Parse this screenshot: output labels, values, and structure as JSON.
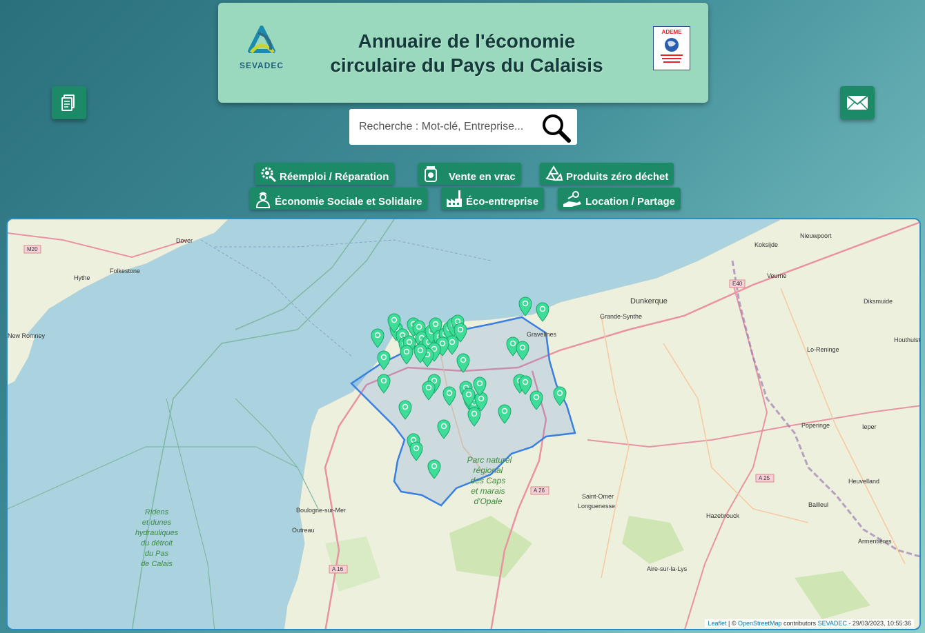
{
  "header": {
    "title_line1": "Annuaire de l'économie",
    "title_line2": "circulaire du Pays du Calaisis",
    "logo_left_text": "SEVADEC",
    "logo_right_text": "ADEME"
  },
  "search": {
    "placeholder": "Recherche : Mot-clé, Entreprise..."
  },
  "categories": [
    {
      "label": "Réemploi / Réparation"
    },
    {
      "label": "Vente en vrac"
    },
    {
      "label": "Produits zéro déchet"
    },
    {
      "label": "Économie Sociale et Solidaire"
    },
    {
      "label": "Éco-entreprise"
    },
    {
      "label": "Location / Partage"
    }
  ],
  "map": {
    "places": [
      "Dover",
      "Folkestone",
      "Hythe",
      "New Romney",
      "Dunkerque",
      "Grande-Synthe",
      "Gravelines",
      "Koksijde",
      "Nieuwpoort",
      "Veurne",
      "Diksmuide",
      "Houthulst",
      "Lo-Reninge",
      "Poperinge",
      "Ieper",
      "Heuvelland",
      "Bailleul",
      "Hazebrouck",
      "Armentières",
      "Saint-Omer",
      "Longuenesse",
      "Boulogne-sur-Mer",
      "Outreau",
      "Aire-sur-la-Lys"
    ],
    "roads": [
      "M20",
      "E40",
      "A 25",
      "A 26",
      "A 16",
      "A 16"
    ],
    "park_label": [
      "Parc naturel",
      "régional",
      "des Caps",
      "et marais",
      "d'Opale"
    ],
    "sea_label": [
      "Ridens",
      "et dunes",
      "hydrauliques",
      "du détroit",
      "du Pas",
      "de Calais"
    ],
    "marker_color": "#3ddc97",
    "boundary_color": "#3a7fe0"
  },
  "attribution": {
    "leaflet": "Leaflet",
    "sep": " | © ",
    "osm": "OpenStreetMap",
    "contrib": " contributors ",
    "sevadec": "SEVADEC",
    "date": " - 29/03/2023, 10:55:36"
  },
  "colors": {
    "button_green": "#1c8a67",
    "header_bg": "#9bd9bf",
    "sea": "#aad3df",
    "land": "#eef0de"
  }
}
